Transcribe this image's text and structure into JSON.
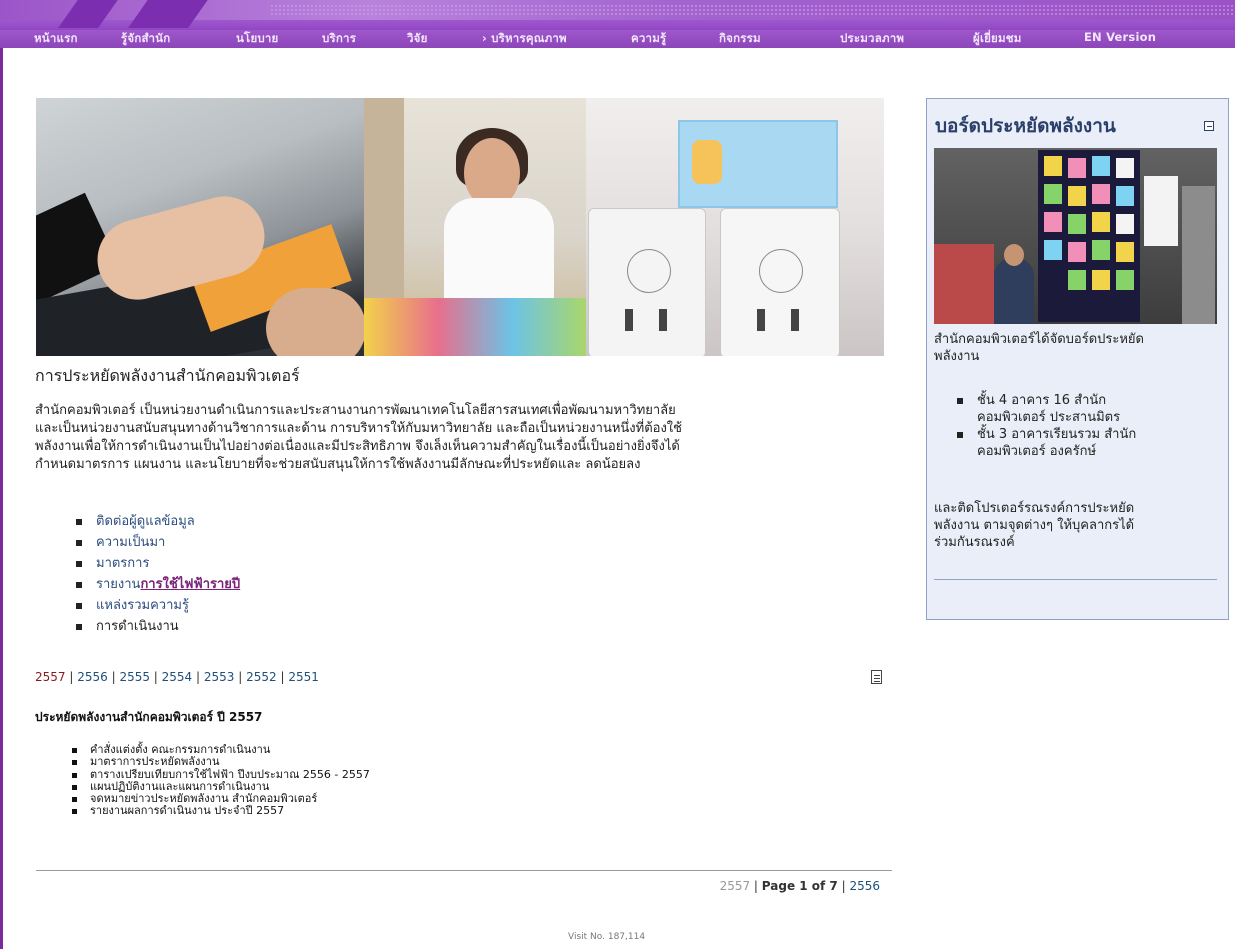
{
  "nav": [
    "หน้าแรก",
    "รู้จักสำนัก",
    "นโยบาย",
    "บริการ",
    "วิจัย",
    "› บริหารคุณภาพ",
    "ความรู้",
    "กิจกรรม",
    "ประมวลภาพ",
    "ผู้เยี่ยมชม",
    "EN Version"
  ],
  "main": {
    "title": "การประหยัดพลังงานสำนักคอมพิวเตอร์",
    "intro_lines": [
      "สำนักคอมพิวเตอร์ เป็นหน่วยงานดำเนินการและประสานงานการพัฒนาเทคโนโลยีสารสนเทศเพื่อพัฒนามหาวิทยาลัย",
      "และเป็นหน่วยงานสนับสนุนทางด้านวิชาการและด้าน การบริหารให้กับมหาวิทยาลัย และถือเป็นหน่วยงานหนึ่งที่ต้องใช้",
      "พลังงานเพื่อให้การดำเนินงานเป็นไปอย่างต่อเนื่องและมีประสิทธิภาพ จึงเล็งเห็นความสำคัญในเรื่องนี้เป็นอย่างยิ่งจึงได้",
      "กำหนดมาตรการ แผนงาน และนโยบายที่จะช่วยสนับสนุนให้การใช้พลังงานมีลักษณะที่ประหยัดและ ลดน้อยลง"
    ],
    "links": {
      "contact": "ติดต่อผู้ดูแลข้อมูล",
      "history": "ความเป็นมา",
      "measures": "มาตรการ",
      "report_prefix": "รายงาน",
      "report_link": "การใช้ไฟฟ้ารายปี",
      "knowledge": "แหล่งรวมความรู้",
      "operation": "การดำเนินงาน"
    },
    "years": [
      "2557",
      "2556",
      "2555",
      "2554",
      "2553",
      "2552",
      "2551"
    ],
    "year_separator": " | ",
    "subhead": "ประหยัดพลังงานสำนักคอมพิวเตอร์ ปี 2557",
    "sublist": [
      "คำสั่งแต่งตั้ง คณะกรรมการดำเนินงาน",
      "มาตราการประหยัดพลังงาน",
      "ตารางเปรียบเทียบการใช้ไฟฟ้า  ปีงบประมาณ 2556 - 2557",
      "แผนปฏิบัติงานและแผนการดำเนินงาน",
      "จดหมายข่าวประหยัดพลังงาน  สำนักคอมพิวเตอร์",
      "รายงานผลการดำเนินงาน  ประจำปี 2557"
    ],
    "pager": {
      "current_year": "2557",
      "page_text": "Page 1 of 7",
      "next_year": "2556",
      "separator": " | "
    },
    "visit": "Visit No. 187,114"
  },
  "sidebar": {
    "title": "บอร์ดประหยัดพลังงาน",
    "text_lines": [
      "สำนักคอมพิวเตอร์ได้จัดบอร์ดประหยัด",
      "พลังงาน"
    ],
    "list": [
      [
        "ชั้น 4 อาคาร 16 สำนัก",
        "คอมพิวเตอร์ ประสานมิตร"
      ],
      [
        "ชั้น 3 อาคารเรียนรวม สำนัก",
        "คอมพิวเตอร์ องครักษ์"
      ]
    ],
    "text2_lines": [
      " และติดโปรเตอร์รณรงค์การประหยัด",
      "พลังงาน ตามจุดต่างๆ ให้บุคลากรได้",
      "ร่วมกันรณรงค์"
    ]
  },
  "colors": {
    "nav_bg": "#8d3ec0",
    "link": "#2b4c7e",
    "visited_link": "#7a2378",
    "current_year": "#8b1a1a",
    "sidebar_bg": "#e9eef8",
    "sidebar_border": "#8fa3c6"
  },
  "icons": [
    "document-icon",
    "collapse-icon"
  ]
}
